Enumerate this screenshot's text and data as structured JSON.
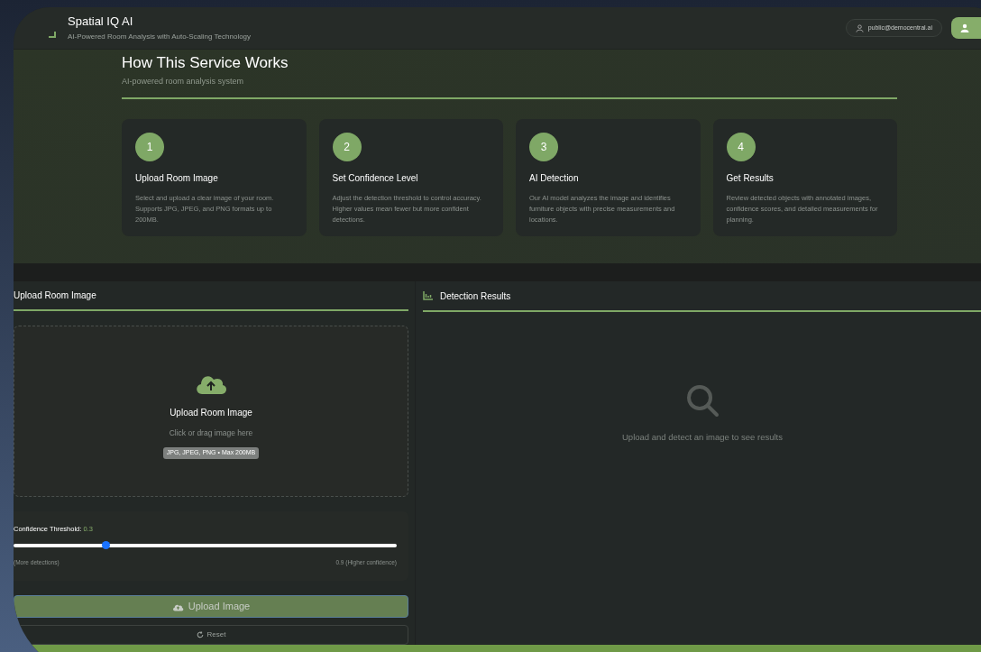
{
  "header": {
    "title": "Spatial IQ AI",
    "subtitle": "AI-Powered Room Analysis with Auto-Scaling Technology",
    "user": "public@democentral.ai"
  },
  "intro": {
    "title": "How This Service Works",
    "subtitle": "AI-powered room analysis system",
    "steps": [
      {
        "number": "1",
        "title": "Upload Room Image",
        "text": "Select and upload a clear image of your room. Supports JPG, JPEG, and PNG formats up to 200MB."
      },
      {
        "number": "2",
        "title": "Set Confidence Level",
        "text": "Adjust the detection threshold to control accuracy. Higher values mean fewer but more confident detections."
      },
      {
        "number": "3",
        "title": "AI Detection",
        "text": "Our AI model analyzes the image and identifies furniture objects with precise measurements and locations."
      },
      {
        "number": "4",
        "title": "Get Results",
        "text": "Review detected objects with annotated images, confidence scores, and detailed measurements for planning."
      }
    ]
  },
  "upload_panel": {
    "title": "Upload Room Image",
    "dropzone": {
      "title": "Upload Room Image",
      "hint": "Click or drag image here",
      "formats": "JPG, JPEG, PNG • Max 200MB"
    },
    "slider": {
      "label": "Confidence Threshold:",
      "value": "0.3",
      "level": 0.24,
      "min_label": "(More detections)",
      "max_label": "0.9 (Higher confidence)"
    },
    "upload_button": "Upload Image",
    "reset_button": "Reset"
  },
  "results_panel": {
    "title": "Detection Results",
    "empty_text": "Upload and detect an image to see results"
  }
}
